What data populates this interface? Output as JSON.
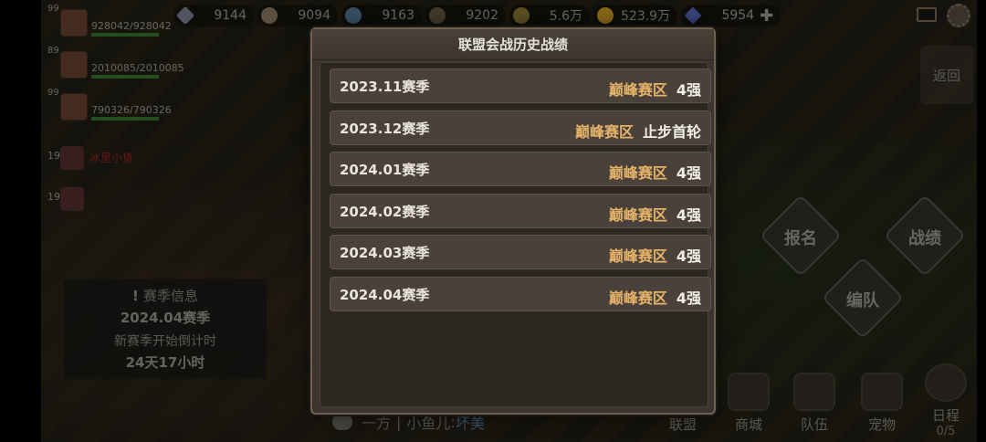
{
  "resources": [
    {
      "icon": "stone-icon",
      "value": "9144"
    },
    {
      "icon": "ore-icon",
      "value": "9094"
    },
    {
      "icon": "crystal-icon",
      "value": "9163"
    },
    {
      "icon": "wood-icon",
      "value": "9202"
    },
    {
      "icon": "wheat-icon",
      "value": "5.6万"
    },
    {
      "icon": "gold-coin-icon",
      "value": "523.9万"
    },
    {
      "icon": "diamond-icon",
      "value": "5954"
    }
  ],
  "team": [
    {
      "level": "99",
      "hp": "928042/928042",
      "hp_fraction": 1.0
    },
    {
      "level": "89",
      "hp": "2010085/2010085",
      "hp_fraction": 1.0
    },
    {
      "level": "99",
      "hp": "790326/790326",
      "hp_fraction": 1.0
    }
  ],
  "team_extra": [
    {
      "level": "19",
      "name": "冰里小鱼"
    },
    {
      "level": "19",
      "name": ""
    }
  ],
  "season_info": {
    "title": "赛季信息",
    "season": "2024.04赛季",
    "countdown_label": "新赛季开始倒计时",
    "countdown": "24天17小时"
  },
  "chat": {
    "channel": "一方",
    "sender": "小鱼儿",
    "message": "坏美"
  },
  "side_buttons": {
    "back": "返回",
    "signup": "报名",
    "record": "战绩",
    "formation": "编队"
  },
  "bottom_nav": [
    {
      "label": "联盟",
      "icon": "alliance-icon"
    },
    {
      "label": "商城",
      "icon": "shop-cart-icon"
    },
    {
      "label": "队伍",
      "icon": "team-icon"
    },
    {
      "label": "宠物",
      "icon": "pet-paw-icon"
    },
    {
      "label": "日程",
      "icon": "schedule-icon",
      "sub": "0/5"
    }
  ],
  "modal": {
    "title": "联盟会战历史战绩",
    "records": [
      {
        "season": "2023.11赛季",
        "division": "巅峰赛区",
        "result": "4强"
      },
      {
        "season": "2023.12赛季",
        "division": "巅峰赛区",
        "result": "止步首轮"
      },
      {
        "season": "2024.01赛季",
        "division": "巅峰赛区",
        "result": "4强"
      },
      {
        "season": "2024.02赛季",
        "division": "巅峰赛区",
        "result": "4强"
      },
      {
        "season": "2024.03赛季",
        "division": "巅峰赛区",
        "result": "4强"
      },
      {
        "season": "2024.04赛季",
        "division": "巅峰赛区",
        "result": "4强"
      }
    ]
  }
}
